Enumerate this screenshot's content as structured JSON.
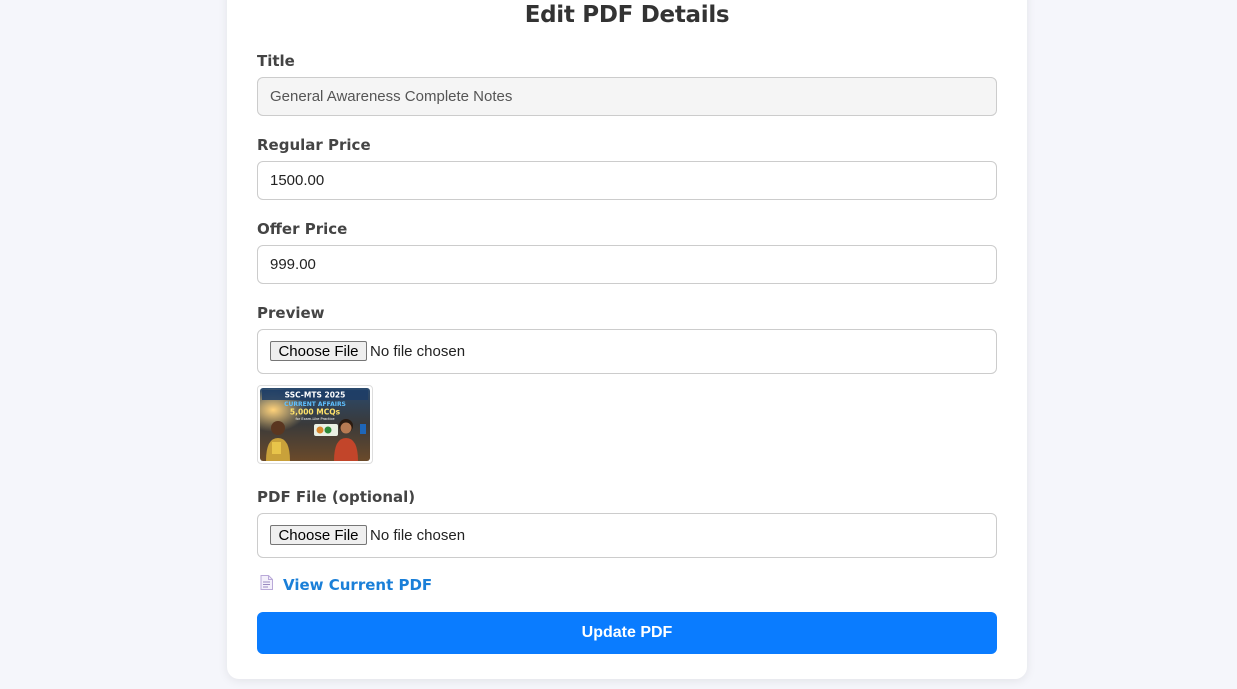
{
  "form": {
    "heading": "Edit PDF Details",
    "title": {
      "label": "Title",
      "value": "General Awareness Complete Notes"
    },
    "regular_price": {
      "label": "Regular Price",
      "value": "1500.00"
    },
    "offer_price": {
      "label": "Offer Price",
      "value": "999.00"
    },
    "preview": {
      "label": "Preview",
      "button": "Choose File",
      "status": "No file chosen",
      "thumbnail": {
        "line1": "SSC-MTS 2025",
        "line2": "CURRENT AFFAIRS",
        "line3": "5,000 MCQs",
        "line4": "for Exam-Like Practice"
      }
    },
    "pdf_file": {
      "label": "PDF File (optional)",
      "button": "Choose File",
      "status": "No file chosen"
    },
    "view_pdf_link": "View Current PDF",
    "view_pdf_icon": "document-icon",
    "submit": "Update PDF"
  },
  "colors": {
    "background": "#f5f6fb",
    "accent": "#0a7cff",
    "link": "#1a7fd8"
  }
}
